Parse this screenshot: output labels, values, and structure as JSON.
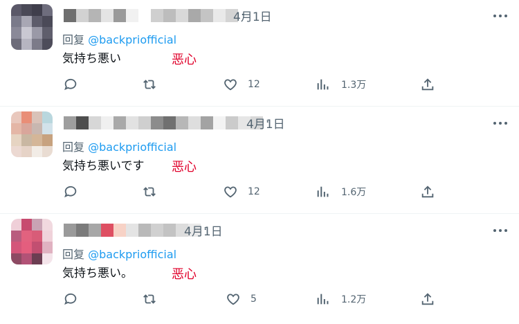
{
  "tweets": [
    {
      "date": "4月1日",
      "reply_prefix": "回复",
      "reply_handle": "@backpriofficial",
      "text": "気持ち悪い",
      "annotation": "恶心",
      "likes": "12",
      "views": "1.3万",
      "avatar_colors": [
        "#5a5868",
        "#4a4957",
        "#3f3e4c",
        "#6e6d7d",
        "#7a7a8a",
        "#a8a7b4",
        "#5d5c6b",
        "#4b4a58",
        "#8a8998",
        "#c9c8d2",
        "#9a99a7",
        "#5f5e6c",
        "#6d6c7a",
        "#b6b5c1",
        "#7c7b89",
        "#4d4c5a"
      ],
      "name_blur_colors": [
        "#6f6f6f",
        "#d2d2d2",
        "#b5b5b5",
        "#e4e4e4",
        "#9a9a9a",
        "#f1f1f1",
        "#ffffff",
        "#cfcfcf",
        "#bdbdbd",
        "#d9d9d9",
        "#a9a9a9",
        "#c4c4c4",
        "#e9e9e9",
        "#d4d4d4"
      ]
    },
    {
      "date": "4月1日",
      "reply_prefix": "回复",
      "reply_handle": "@backpriofficial",
      "text": "気持ち悪いです",
      "annotation": "恶心",
      "likes": "12",
      "views": "1.6万",
      "avatar_colors": [
        "#e9c8bd",
        "#e98e77",
        "#d9c2b8",
        "#b9d7de",
        "#e4b6a6",
        "#d9a69b",
        "#c8b7b0",
        "#d2e2ea",
        "#e6d4c2",
        "#c9b7a2",
        "#d4b698",
        "#c7a27f",
        "#ecd9d2",
        "#e6d3c7",
        "#f2ece6",
        "#e9dcd2"
      ],
      "name_blur_colors": [
        "#9e9e9e",
        "#4e4e4e",
        "#d7d7d7",
        "#f0f0f0",
        "#a9a9a9",
        "#e2e2e2",
        "#cfcfcf",
        "#8c8c8c",
        "#707070",
        "#b7b7b7",
        "#dedede",
        "#a3a3a3",
        "#f3f3f3",
        "#cbcbcb",
        "#e6e6e6",
        "#d8d8d8"
      ]
    },
    {
      "date": "4月1日",
      "reply_prefix": "回复",
      "reply_handle": "@backpriofficial",
      "text": "気持ち悪い。",
      "annotation": "恶心",
      "likes": "5",
      "views": "1.2万",
      "avatar_colors": [
        "#efcfd8",
        "#c74b6f",
        "#c9a3b4",
        "#f1d9df",
        "#b95c7e",
        "#e2627f",
        "#d85c78",
        "#f0d2da",
        "#d4567a",
        "#e45e7e",
        "#c24f71",
        "#e0b2c1",
        "#8d4a63",
        "#b25276",
        "#6c3e52",
        "#f4e4ea"
      ],
      "name_blur_colors": [
        "#9a9a9a",
        "#7b7b7b",
        "#a7a7a7",
        "#de4f62",
        "#f7d2c6",
        "#e4e4e4",
        "#b9b9b9",
        "#d0d0d0",
        "#c3c3c3",
        "#dddddd",
        "#eaeaea"
      ]
    }
  ]
}
